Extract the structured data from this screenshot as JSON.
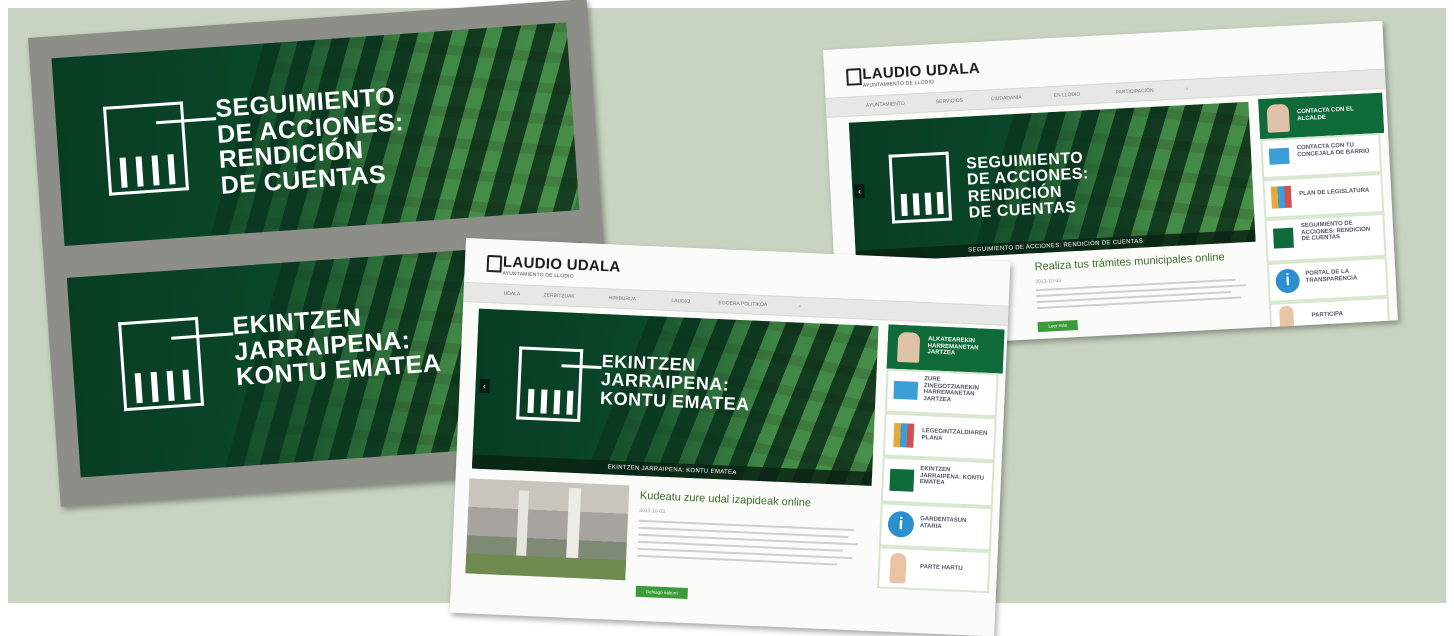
{
  "collage": {
    "banners": [
      {
        "text_lines": [
          "SEGUIMIENTO",
          "DE ACCIONES:",
          "RENDICIÓN",
          "DE CUENTAS"
        ]
      },
      {
        "text_lines": [
          "EKINTZEN",
          "JARRAIPENA:",
          "KONTU EMATEA"
        ]
      }
    ],
    "page_eu": {
      "brand": "LAUDIO UDALA",
      "brand_sub": "AYUNTAMIENTO DE LLODIO",
      "nav": [
        "UDALA",
        "ZERBITZUAK",
        "HIRIBURUA",
        "LAUDIO",
        "EGOERA POLITIKOA"
      ],
      "banner_lines": [
        "EKINTZEN",
        "JARRAIPENA:",
        "KONTU EMATEA"
      ],
      "slider_caption": "EKINTZEN JARRAIPENA: KONTU EMATEA",
      "article_title": "Kudeatu zure udal izapideak online",
      "article_date": "2013-10-03",
      "button": "Gehiago irakurri",
      "sidebar": [
        "ALKATEAREKIN HARREMANETAN JARTZEA",
        "ZURE ZINEGOTZIAREKIN HARREMANETAN JARTZEA",
        "LEGEGINTZALDIAREN PLANA",
        "EKINTZEN JARRAIPENA: KONTU EMATEA",
        "GARDENTASUN ATARIA",
        "PARTE HARTU"
      ]
    },
    "page_es": {
      "brand": "LAUDIO UDALA",
      "brand_sub": "AYUNTAMIENTO DE LLODIO",
      "nav": [
        "AYUNTAMIENTO",
        "SERVICIOS",
        "CIUDADANÍA",
        "EN LLODIO",
        "PARTICIPACIÓN"
      ],
      "banner_lines": [
        "SEGUIMIENTO",
        "DE ACCIONES:",
        "RENDICIÓN",
        "DE CUENTAS"
      ],
      "slider_caption": "SEGUIMIENTO DE ACCIONES: RENDICIÓN DE CUENTAS",
      "article_title": "Realiza tus trámites municipales online",
      "article_date": "2013-10-03",
      "button": "Leer más",
      "sidebar": [
        "CONTACTA CON EL ALCALDE",
        "CONTACTA CON TU CONCEJALA DE BARRIO",
        "PLAN DE LEGISLATURA",
        "SEGUIMIENTO DE ACCIONES: RENDICIÓN DE CUENTAS",
        "PORTAL DE LA TRANSPARENCIA",
        "PARTICIPA"
      ]
    }
  },
  "colors": {
    "background": "#c8d3c1",
    "banner_green": "#0f5b34",
    "accent_green": "#3b9a3a"
  }
}
